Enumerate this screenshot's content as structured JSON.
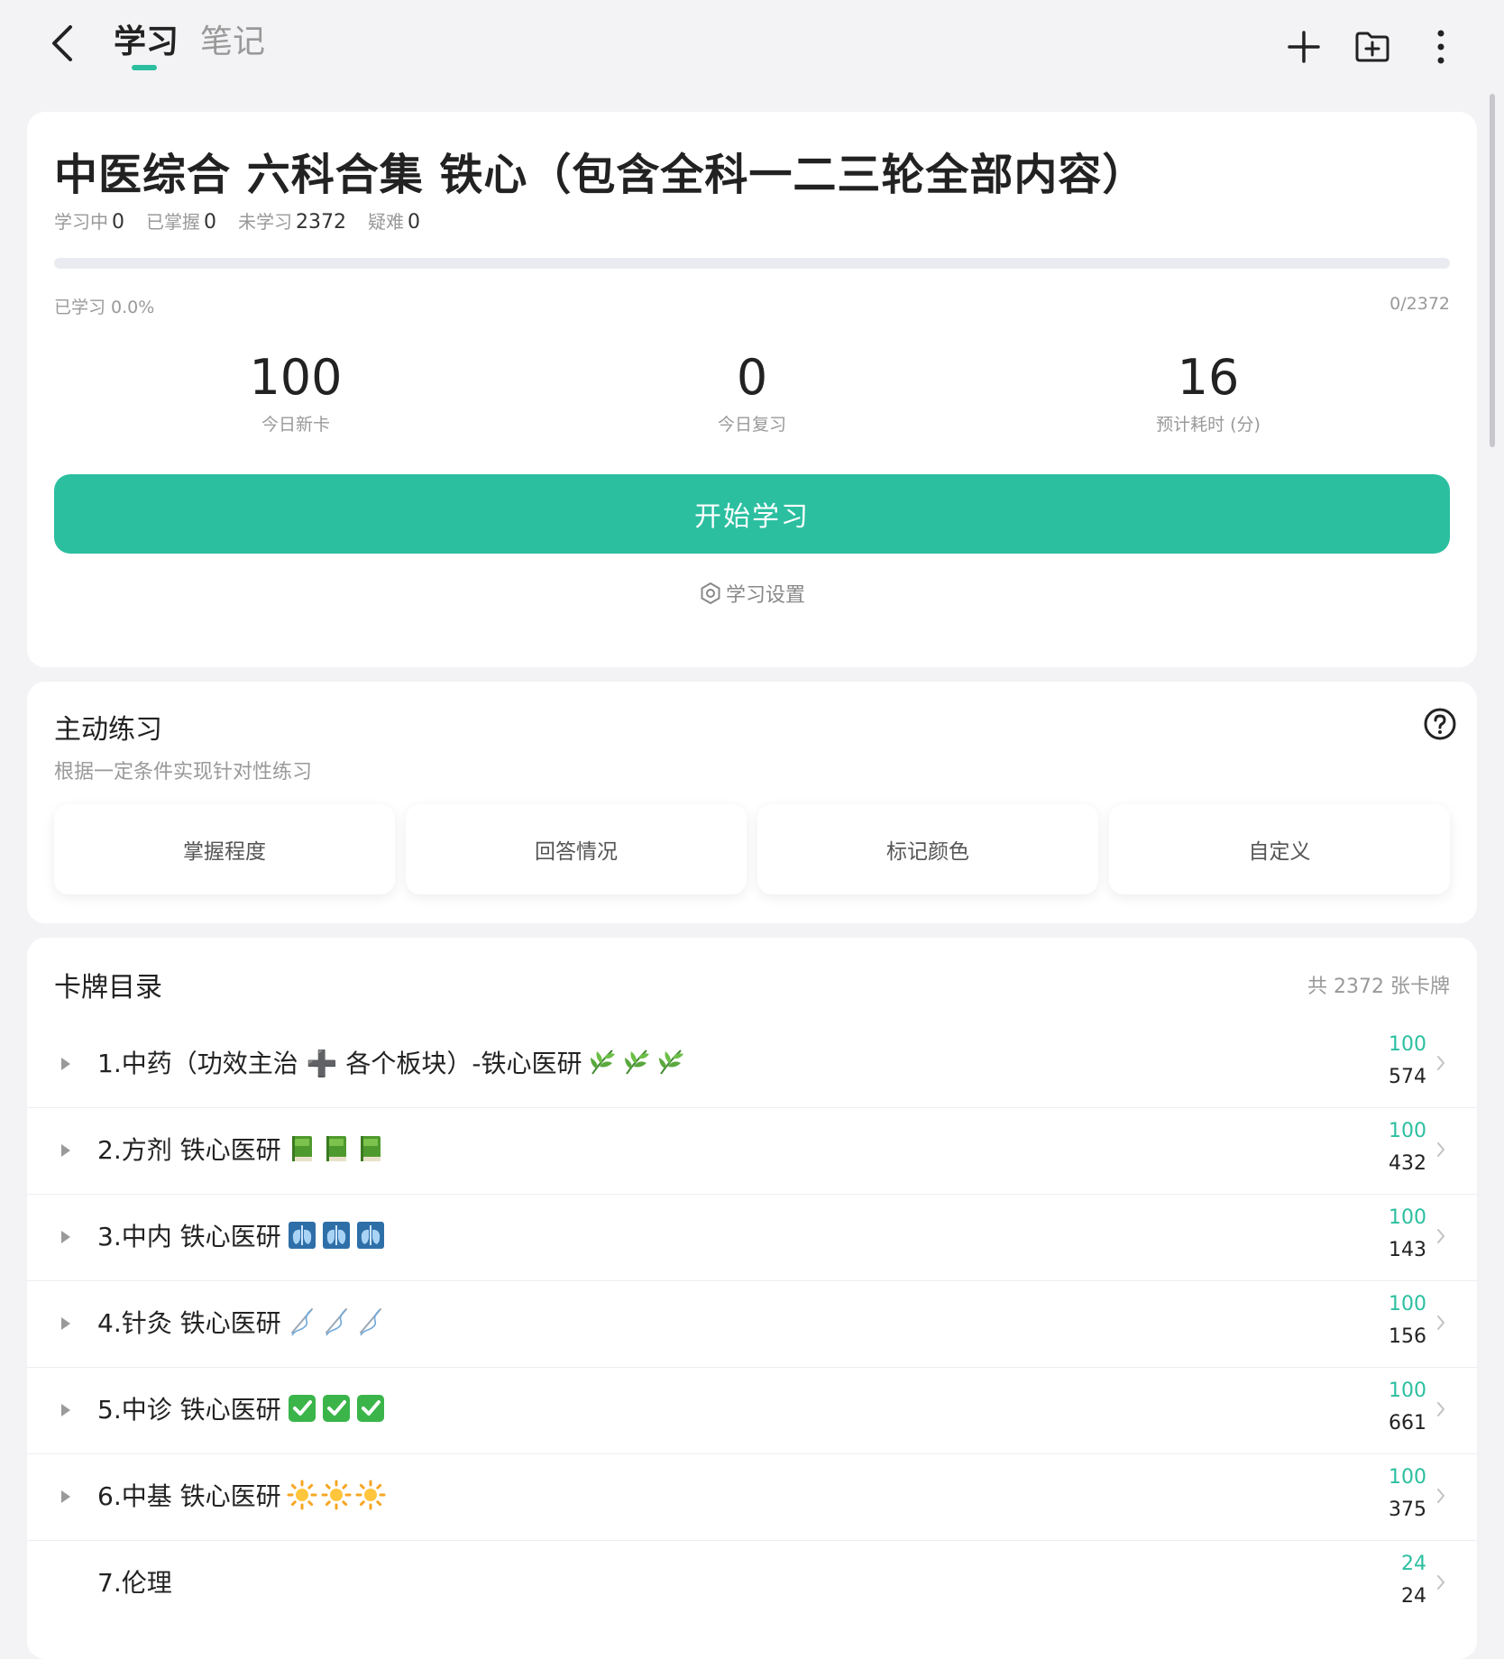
{
  "nav": {
    "tabs": [
      {
        "label": "学习",
        "active": true
      },
      {
        "label": "笔记",
        "active": false
      }
    ]
  },
  "deck": {
    "title": "中医综合 六科合集 铁心（包含全科一二三轮全部内容）",
    "stats": [
      {
        "label": "学习中",
        "value": "0"
      },
      {
        "label": "已掌握",
        "value": "0"
      },
      {
        "label": "未学习",
        "value": "2372"
      },
      {
        "label": "疑难",
        "value": "0"
      }
    ],
    "progress_fraction": 0.0,
    "progress_text": "已学习 0.0%",
    "progress_count": "0/2372",
    "today": [
      {
        "value": "100",
        "label": "今日新卡"
      },
      {
        "value": "0",
        "label": "今日复习"
      },
      {
        "value": "16",
        "label": "预计耗时 (分)"
      }
    ],
    "start_button": "开始学习",
    "settings_link": "学习设置"
  },
  "practice": {
    "title": "主动练习",
    "subtitle": "根据一定条件实现针对性练习",
    "filters": [
      "掌握程度",
      "回答情况",
      "标记颜色",
      "自定义"
    ]
  },
  "catalog": {
    "title": "卡牌目录",
    "count": "共 2372 张卡牌",
    "rows": [
      {
        "name": "1.中药（功效主治 ➕ 各个板块）-铁心医研",
        "emoji": "herb",
        "new": "100",
        "total": "574",
        "expandable": true
      },
      {
        "name": "2.方剂 铁心医研",
        "emoji": "book",
        "new": "100",
        "total": "432",
        "expandable": true
      },
      {
        "name": "3.中内 铁心医研",
        "emoji": "xray",
        "new": "100",
        "total": "143",
        "expandable": true
      },
      {
        "name": "4.针灸 铁心医研",
        "emoji": "needle",
        "new": "100",
        "total": "156",
        "expandable": true
      },
      {
        "name": "5.中诊 铁心医研",
        "emoji": "check",
        "new": "100",
        "total": "661",
        "expandable": true
      },
      {
        "name": "6.中基 铁心医研",
        "emoji": "sun",
        "new": "100",
        "total": "375",
        "expandable": true
      },
      {
        "name": "7.伦理",
        "emoji": "",
        "new": "24",
        "total": "24",
        "expandable": false
      }
    ]
  },
  "colors": {
    "accent": "#2bbfa0",
    "background": "#f3f3f5",
    "card": "#ffffff"
  }
}
